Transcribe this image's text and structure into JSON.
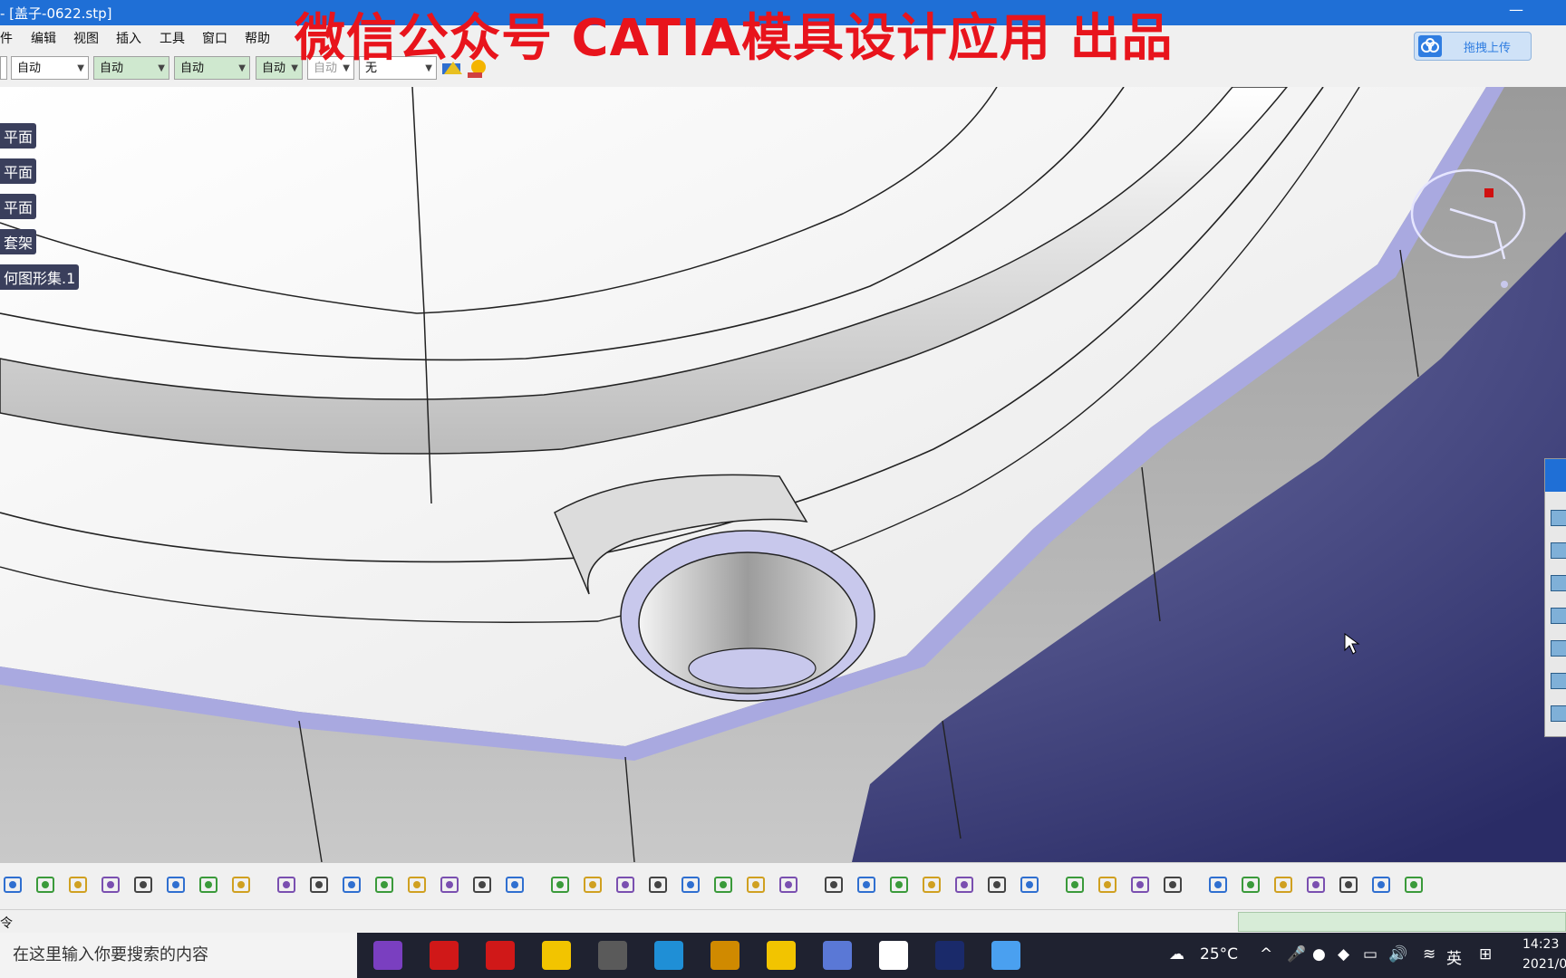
{
  "window": {
    "title": "- [盖子-0622.stp]",
    "minimize": "—"
  },
  "watermark": "微信公众号 CATIA模具设计应用 出品",
  "menu": [
    "件",
    "编辑",
    "视图",
    "插入",
    "工具",
    "窗口",
    "帮助"
  ],
  "combos": [
    {
      "value": "自动"
    },
    {
      "value": "自动"
    },
    {
      "value": "自动"
    },
    {
      "value": "自动"
    },
    {
      "value": "自动"
    },
    {
      "value": "无"
    }
  ],
  "upload": {
    "label": "拖拽上传"
  },
  "tree": [
    "平面",
    "平面",
    "平面",
    "套架",
    "何图形集.1"
  ],
  "status": {
    "command_label": "令"
  },
  "taskbar": {
    "search_placeholder": "在这里输入你要搜索的内容",
    "weather": "25°C",
    "ime": "英",
    "clock_time": "14:23",
    "clock_date": "2021/0"
  },
  "colors": {
    "background": "#2d2f6b",
    "titlebar": "#1f6fd6",
    "watermark": "#e8141c",
    "part_surface": "#f2f2f2",
    "part_edge": "#a9a9e0"
  },
  "icons": {
    "bottom_toolbar": [
      "save-icon",
      "print-icon",
      "cut-icon",
      "copy-icon",
      "paste-icon",
      "undo-icon",
      "redo-icon",
      "whats-this-icon",
      "formula-icon",
      "comment-icon",
      "divider-icon",
      "table-icon",
      "graph-icon",
      "lock-icon",
      "tree-icon",
      "fly-icon",
      "fit-all-icon",
      "pan-icon",
      "rotate-icon",
      "zoom-in-icon",
      "zoom-out-icon",
      "normal-view-icon",
      "multi-view-icon",
      "iso-view-icon",
      "shading-icon",
      "render-icon",
      "hide-show-icon",
      "swap-icon",
      "measure-icon",
      "inertia-icon",
      "weight-icon",
      "camera-icon",
      "axis-icon",
      "compass-icon",
      "grab-icon",
      "axis-system-icon",
      "dimension-icon",
      "section-icon",
      "mirror-icon",
      "layer-icon",
      "layer2-icon",
      "layer3-icon"
    ],
    "taskbar_apps": [
      "onenote-icon",
      "youdao-icon",
      "music-icon",
      "sticky-notes-icon",
      "paint-icon",
      "edge-icon",
      "jetbrains-icon",
      "folder-icon",
      "photos-icon",
      "car-icon",
      "catia-icon",
      "app-icon"
    ]
  }
}
